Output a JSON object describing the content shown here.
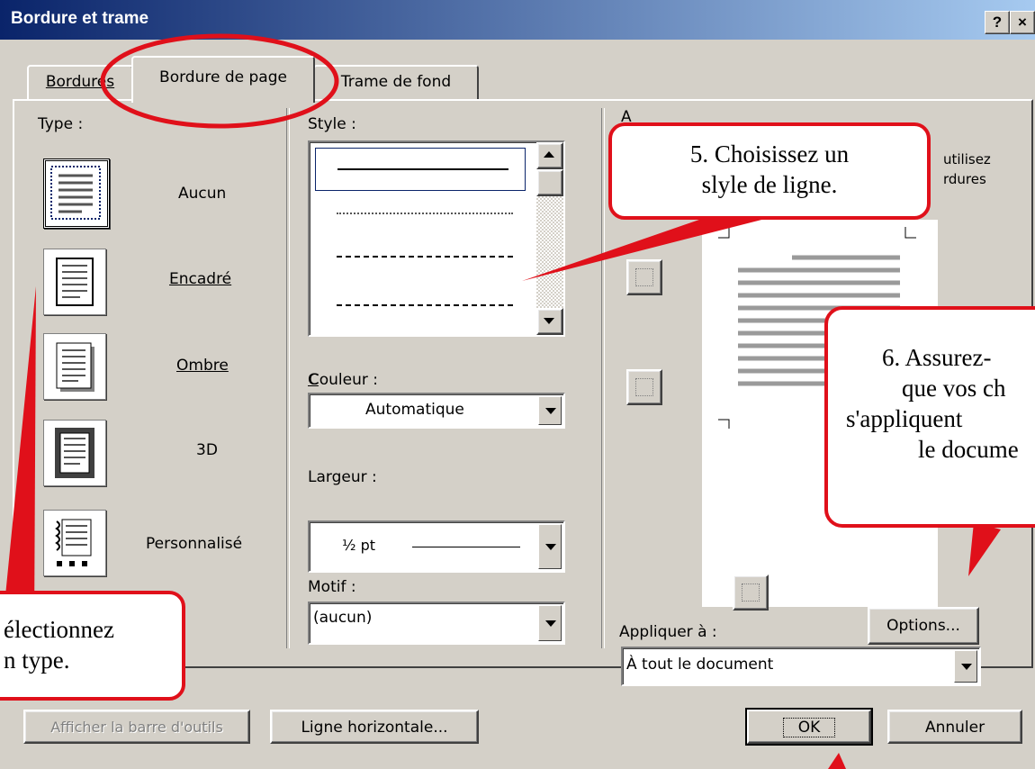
{
  "window": {
    "title": "Bordure et trame",
    "help_label": "?",
    "close_label": "×"
  },
  "tabs": [
    {
      "label": "Bordures",
      "active": false
    },
    {
      "label": "Bordure de page",
      "active": true
    },
    {
      "label": "Trame de fond",
      "active": false
    }
  ],
  "type_section": {
    "heading": "Type :",
    "options": [
      {
        "label": "Aucun"
      },
      {
        "label": "Encadré"
      },
      {
        "label": "Ombre"
      },
      {
        "label": "3D"
      },
      {
        "label": "Personnalisé"
      }
    ]
  },
  "style_section": {
    "heading": "Style :",
    "color_label": "Couleur :",
    "color_value": "Automatique",
    "width_label": "Largeur :",
    "width_value": "½ pt",
    "motif_label": "Motif :",
    "motif_value": "(aucun)"
  },
  "preview_section": {
    "heading": "A",
    "hint_line1": "utilisez",
    "hint_line2": "rdures",
    "apply_label": "Appliquer à :",
    "apply_value": "À tout le document",
    "options_button": "Options..."
  },
  "footer": {
    "toolbar_button": "Afficher la barre d'outils",
    "horizontal_line_button": "Ligne horizontale...",
    "ok_button": "OK",
    "cancel_button": "Annuler"
  },
  "callouts": {
    "step5_line1": "5.  Choisissez un",
    "step5_line2": "slyle de ligne.",
    "step6_line1": "6.  Assurez-",
    "step6_line2": "que vos ch",
    "step6_line3": "s'appliquent",
    "step6_line4": "le docume",
    "step4_line1": "électionnez",
    "step4_line2": "n type."
  },
  "colors": {
    "annotation_red": "#e0101a",
    "titlebar_start": "#0a246a",
    "titlebar_end": "#a6caf0",
    "dialog_gray": "#d4d0c8"
  }
}
